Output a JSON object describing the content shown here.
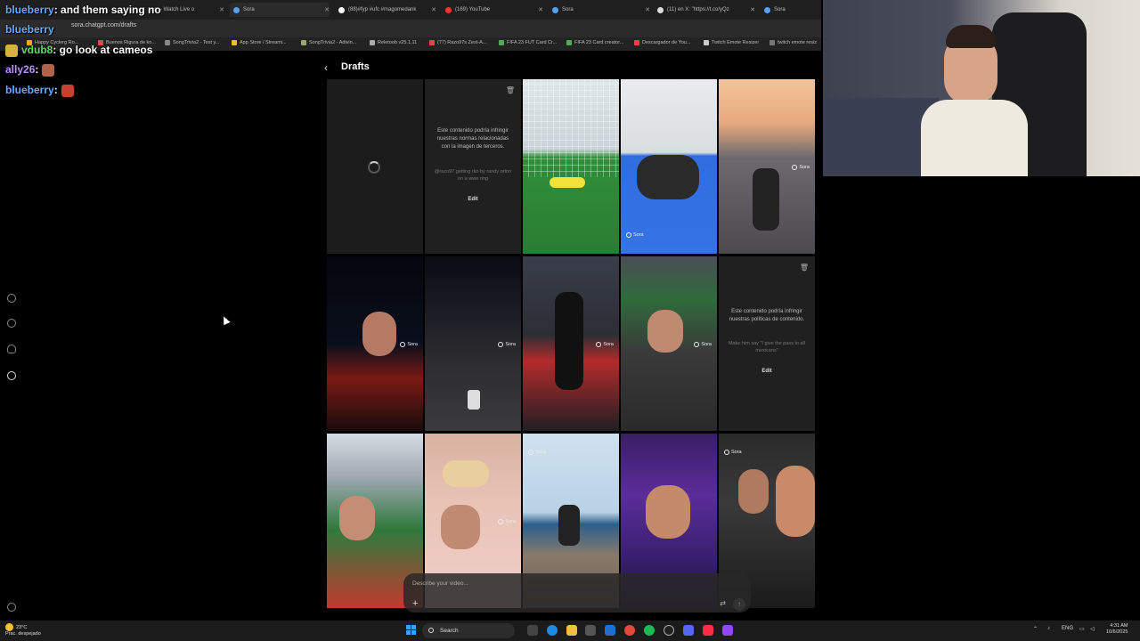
{
  "browser": {
    "tabs": [
      {
        "label": "am - Watch Live o",
        "active": false
      },
      {
        "label": "Sora",
        "active": true
      },
      {
        "label": "(88)#fyp #ufc #magomedank",
        "active": false
      },
      {
        "label": "(169) YouTube",
        "active": false
      },
      {
        "label": "Sora",
        "active": false
      },
      {
        "label": "(11) en X: \"https://t.co/yQz",
        "active": false
      },
      {
        "label": "Sora",
        "active": false
      }
    ],
    "url": "sora.chatgpt.com/drafts",
    "bookmarks": [
      "Happy Cyclerg Ro...",
      "Buenos Rigura de ko...",
      "SongTrivia2 - Test y...",
      "App Store / Streami...",
      "SongTrivia2 - Adivin...",
      "Reletoob v25.1.11",
      "(77) Razo97s Zest-A...",
      "FIFA 23 FUT Card Cr...",
      "FIFA 23 Card creator...",
      "Descargador de You...",
      "Twitch Emote Resizer",
      "twitch emote resiz"
    ]
  },
  "chat": [
    {
      "user": "blueberry",
      "message": ": and them saying no",
      "color": "blue"
    },
    {
      "user": "blueberry",
      "message": "",
      "color": "blue"
    },
    {
      "user": "vdub8",
      "message": ": go look at cameos",
      "color": "green"
    },
    {
      "user": "ally26",
      "message": ":",
      "color": "purple"
    },
    {
      "user": "blueberry",
      "message": ":",
      "color": "blue"
    }
  ],
  "page": {
    "back_icon": "chevron-left-icon",
    "title": "Drafts"
  },
  "tiles": {
    "sora_label": "Sora",
    "blocked_1": {
      "warning": "Este contenido podría infringir nuestras normas relacionadas con la imagen de terceros.",
      "prompt": "@razo97 getting rko by randy orton on a wwe ring",
      "edit": "Edit"
    },
    "blocked_2": {
      "warning": "Este contenido podría infringir nuestras políticas de contenido.",
      "prompt": "Make him say \"I give the pass to all mexicans\"",
      "edit": "Edit"
    }
  },
  "composer": {
    "placeholder": "Describe your video...",
    "plus": "+",
    "send": "↑"
  },
  "taskbar": {
    "weather_temp": "23°C",
    "weather_desc": "Prac. despejado",
    "search": "Search",
    "lang": "ENG",
    "time": "4:31 AM",
    "date": "10/6/2025"
  }
}
